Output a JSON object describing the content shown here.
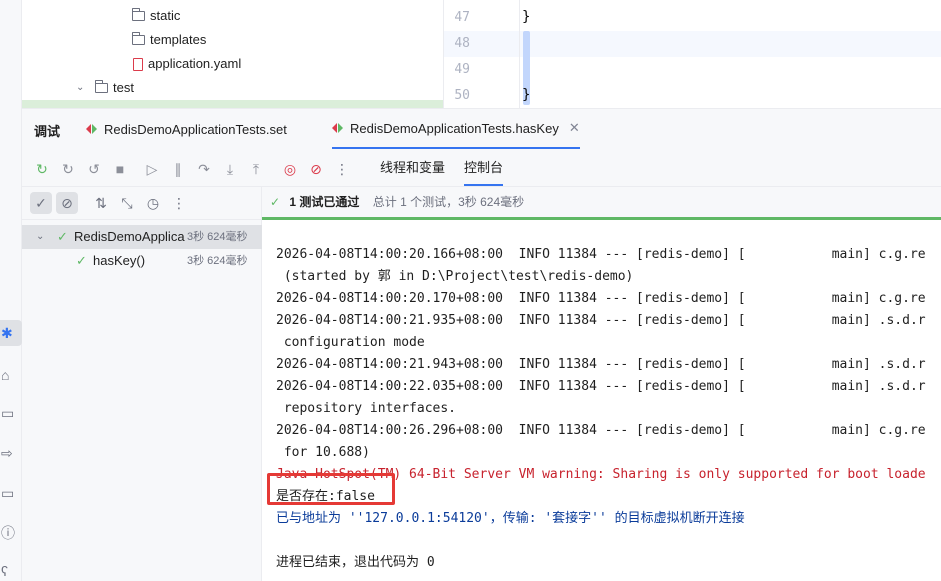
{
  "project_tree": {
    "items": [
      {
        "label": "static",
        "kind": "folder"
      },
      {
        "label": "templates",
        "kind": "folder"
      },
      {
        "label": "application.yaml",
        "kind": "yaml"
      },
      {
        "label": "test",
        "kind": "folder"
      }
    ]
  },
  "editor": {
    "line_numbers": [
      "47",
      "48",
      "49",
      "50"
    ],
    "lines": [
      "    }",
      "",
      "",
      "}"
    ]
  },
  "tool_window": {
    "title": "调试",
    "tabs": [
      {
        "label": "RedisDemoApplicationTests.set",
        "active": false
      },
      {
        "label": "RedisDemoApplicationTests.hasKey",
        "active": true
      }
    ],
    "sub_tabs": [
      {
        "label": "线程和变量",
        "active": false
      },
      {
        "label": "控制台",
        "active": true
      }
    ],
    "more": "⋮"
  },
  "test_tree": {
    "root": {
      "label": "RedisDemoApplica",
      "duration": "3秒 624毫秒"
    },
    "child": {
      "label": "hasKey()",
      "duration": "3秒 624毫秒"
    }
  },
  "status": {
    "passed": "1 测试已通过",
    "total": "总计 1 个测试，3秒 624毫秒"
  },
  "console": {
    "lines": [
      {
        "text": "2026-04-08T14:00:20.166+08:00  INFO 11384 --- [redis-demo] [           main] c.g.re",
        "kind": "normal"
      },
      {
        "text": " (started by 郭 in D:\\Project\\test\\redis-demo)",
        "kind": "normal"
      },
      {
        "text": "2026-04-08T14:00:20.170+08:00  INFO 11384 --- [redis-demo] [           main] c.g.re",
        "kind": "normal"
      },
      {
        "text": "2026-04-08T14:00:21.935+08:00  INFO 11384 --- [redis-demo] [           main] .s.d.r",
        "kind": "normal"
      },
      {
        "text": " configuration mode",
        "kind": "normal"
      },
      {
        "text": "2026-04-08T14:00:21.943+08:00  INFO 11384 --- [redis-demo] [           main] .s.d.r",
        "kind": "normal"
      },
      {
        "text": "2026-04-08T14:00:22.035+08:00  INFO 11384 --- [redis-demo] [           main] .s.d.r",
        "kind": "normal"
      },
      {
        "text": " repository interfaces.",
        "kind": "normal"
      },
      {
        "text": "2026-04-08T14:00:26.296+08:00  INFO 11384 --- [redis-demo] [           main] c.g.re",
        "kind": "normal"
      },
      {
        "text": " for 10.688)",
        "kind": "normal"
      },
      {
        "text": "Java HotSpot(TM) 64-Bit Server VM warning: Sharing is only supported for boot loade",
        "kind": "err"
      },
      {
        "text": "是否存在:false",
        "kind": "normal"
      },
      {
        "text": "已与地址为 ''127.0.0.1:54120'，传输: '套接字'' 的目标虚拟机断开连接",
        "kind": "link"
      },
      {
        "text": "",
        "kind": "normal"
      },
      {
        "text": "进程已结束，退出代码为 0",
        "kind": "normal"
      }
    ]
  },
  "colors": {
    "pass_green": "#5fb865",
    "accent_blue": "#3574f0",
    "error_red": "#c7222d",
    "highlight_red": "#e53935"
  }
}
